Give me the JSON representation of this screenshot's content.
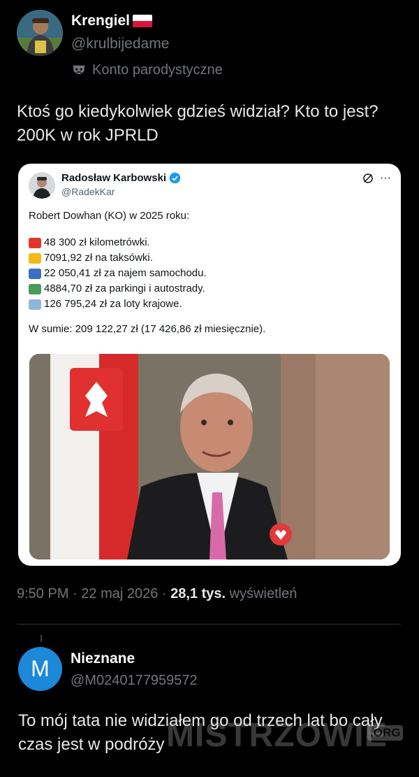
{
  "author": {
    "name": "Krengiel",
    "handle": "@krulbijedame",
    "badge": "Konto parodystyczne",
    "flag_colors": [
      "#ffffff",
      "#dc143c"
    ]
  },
  "tweet": {
    "text": "Ktoś go kiedykolwiek gdzieś widział? Kto to jest? 200K w rok JPRLD"
  },
  "embedded": {
    "name": "Radosław Karbowski",
    "handle": "@RadekKar",
    "actions_icon": "slash-circle-icon",
    "more_label": "···",
    "intro": "Robert Dowhan (KO) w 2025 roku:",
    "lines": [
      {
        "icon": "car-icon",
        "color": "#e0352b",
        "text": "48 300 zł kilometrówki."
      },
      {
        "icon": "taxi-icon",
        "color": "#f2b91b",
        "text": "7091,92 zł na taksówki."
      },
      {
        "icon": "rental-car-icon",
        "color": "#3b6fc4",
        "text": "22 050,41 zł za najem samochodu."
      },
      {
        "icon": "motorway-icon",
        "color": "#4a9a5a",
        "text": "4884,70 zł za parkingi i autostrady."
      },
      {
        "icon": "airplane-icon",
        "color": "#8fb6d8",
        "text": "126 795,24 zł za loty krajowe."
      }
    ],
    "sum": "W sumie: 209 122,27 zł (17 426,86 zł miesięcznie)."
  },
  "meta": {
    "time": "9:50 PM",
    "date": "22 maj 2026",
    "views_count": "28,1 tys.",
    "views_label": "wyświetleń"
  },
  "reply": {
    "avatar_letter": "M",
    "name": "Nieznane",
    "handle": "@M0240177959572",
    "text": "To mój tata nie widziałem go od trzech lat bo cały czas jest w podróży"
  },
  "watermark": {
    "text": "MISTRZOWIE",
    "suffix": ".ORG"
  }
}
